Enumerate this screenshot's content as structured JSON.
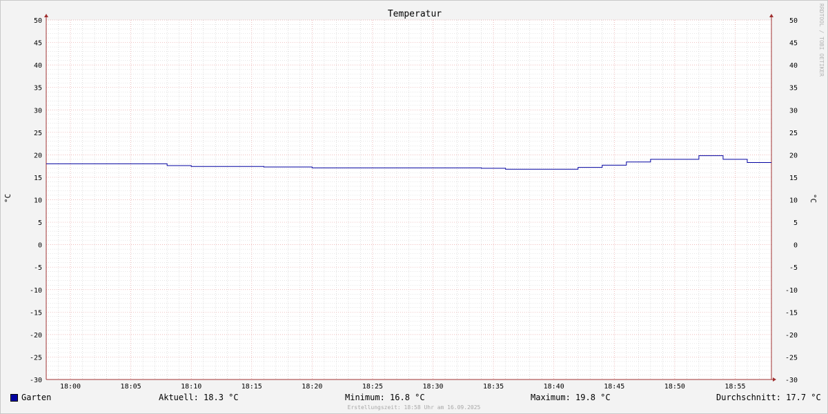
{
  "chart_data": {
    "type": "line",
    "title": "Temperatur",
    "ylabel": "°C",
    "ylabel_right": "°C",
    "xlabel": "",
    "ylim": [
      -30,
      50
    ],
    "yticks": [
      50,
      45,
      40,
      35,
      30,
      25,
      20,
      15,
      10,
      5,
      0,
      -5,
      -10,
      -15,
      -20,
      -25,
      -30
    ],
    "xlim": [
      "17:58",
      "18:58"
    ],
    "xticks": [
      "18:00",
      "18:05",
      "18:10",
      "18:15",
      "18:20",
      "18:25",
      "18:30",
      "18:35",
      "18:40",
      "18:45",
      "18:50",
      "18:55"
    ],
    "grid": true,
    "step": true,
    "series": [
      {
        "name": "Garten",
        "color": "#0000a0",
        "x": [
          "17:58",
          "18:08",
          "18:10",
          "18:16",
          "18:20",
          "18:34",
          "18:36",
          "18:42",
          "18:44",
          "18:46",
          "18:48",
          "18:52",
          "18:54",
          "18:56",
          "18:58"
        ],
        "values": [
          18.0,
          17.6,
          17.4,
          17.3,
          17.1,
          17.0,
          16.8,
          17.2,
          17.7,
          18.4,
          19.0,
          19.8,
          19.0,
          18.3,
          18.3
        ]
      }
    ]
  },
  "legend": {
    "series_name": "Garten",
    "aktuell": "Aktuell: 18.3 °C",
    "minimum": "Minimum: 16.8 °C",
    "maximum": "Maximum: 19.8 °C",
    "durchschnitt": "Durchschnitt: 17.7 °C"
  },
  "footer": {
    "timestamp": "Erstellungszeit: 18:58 Uhr am 16.09.2025"
  },
  "watermark": "RRDTOOL / TOBI OETIKER",
  "colors": {
    "background": "#f3f3f3",
    "plot_area": "#ffffff",
    "series": "#0000a0",
    "major_grid": "#e8a0a0",
    "minor_grid": "#c8c8c8",
    "axis": "#a03030"
  }
}
